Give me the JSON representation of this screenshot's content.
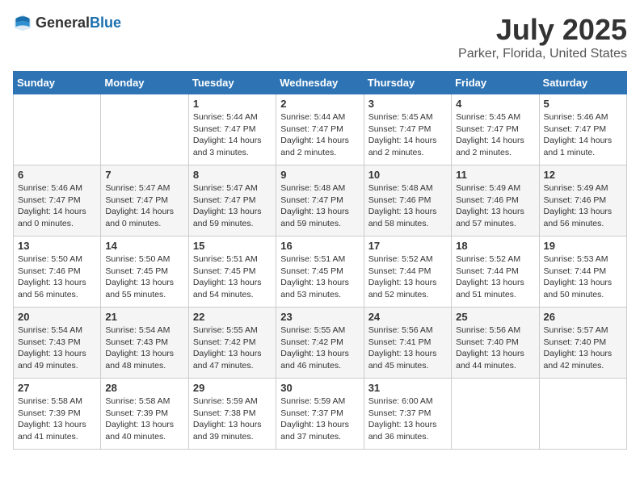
{
  "logo": {
    "general": "General",
    "blue": "Blue"
  },
  "title": {
    "month": "July 2025",
    "location": "Parker, Florida, United States"
  },
  "headers": [
    "Sunday",
    "Monday",
    "Tuesday",
    "Wednesday",
    "Thursday",
    "Friday",
    "Saturday"
  ],
  "weeks": [
    [
      {
        "day": "",
        "info": ""
      },
      {
        "day": "",
        "info": ""
      },
      {
        "day": "1",
        "info": "Sunrise: 5:44 AM\nSunset: 7:47 PM\nDaylight: 14 hours\nand 3 minutes."
      },
      {
        "day": "2",
        "info": "Sunrise: 5:44 AM\nSunset: 7:47 PM\nDaylight: 14 hours\nand 2 minutes."
      },
      {
        "day": "3",
        "info": "Sunrise: 5:45 AM\nSunset: 7:47 PM\nDaylight: 14 hours\nand 2 minutes."
      },
      {
        "day": "4",
        "info": "Sunrise: 5:45 AM\nSunset: 7:47 PM\nDaylight: 14 hours\nand 2 minutes."
      },
      {
        "day": "5",
        "info": "Sunrise: 5:46 AM\nSunset: 7:47 PM\nDaylight: 14 hours\nand 1 minute."
      }
    ],
    [
      {
        "day": "6",
        "info": "Sunrise: 5:46 AM\nSunset: 7:47 PM\nDaylight: 14 hours\nand 0 minutes."
      },
      {
        "day": "7",
        "info": "Sunrise: 5:47 AM\nSunset: 7:47 PM\nDaylight: 14 hours\nand 0 minutes."
      },
      {
        "day": "8",
        "info": "Sunrise: 5:47 AM\nSunset: 7:47 PM\nDaylight: 13 hours\nand 59 minutes."
      },
      {
        "day": "9",
        "info": "Sunrise: 5:48 AM\nSunset: 7:47 PM\nDaylight: 13 hours\nand 59 minutes."
      },
      {
        "day": "10",
        "info": "Sunrise: 5:48 AM\nSunset: 7:46 PM\nDaylight: 13 hours\nand 58 minutes."
      },
      {
        "day": "11",
        "info": "Sunrise: 5:49 AM\nSunset: 7:46 PM\nDaylight: 13 hours\nand 57 minutes."
      },
      {
        "day": "12",
        "info": "Sunrise: 5:49 AM\nSunset: 7:46 PM\nDaylight: 13 hours\nand 56 minutes."
      }
    ],
    [
      {
        "day": "13",
        "info": "Sunrise: 5:50 AM\nSunset: 7:46 PM\nDaylight: 13 hours\nand 56 minutes."
      },
      {
        "day": "14",
        "info": "Sunrise: 5:50 AM\nSunset: 7:45 PM\nDaylight: 13 hours\nand 55 minutes."
      },
      {
        "day": "15",
        "info": "Sunrise: 5:51 AM\nSunset: 7:45 PM\nDaylight: 13 hours\nand 54 minutes."
      },
      {
        "day": "16",
        "info": "Sunrise: 5:51 AM\nSunset: 7:45 PM\nDaylight: 13 hours\nand 53 minutes."
      },
      {
        "day": "17",
        "info": "Sunrise: 5:52 AM\nSunset: 7:44 PM\nDaylight: 13 hours\nand 52 minutes."
      },
      {
        "day": "18",
        "info": "Sunrise: 5:52 AM\nSunset: 7:44 PM\nDaylight: 13 hours\nand 51 minutes."
      },
      {
        "day": "19",
        "info": "Sunrise: 5:53 AM\nSunset: 7:44 PM\nDaylight: 13 hours\nand 50 minutes."
      }
    ],
    [
      {
        "day": "20",
        "info": "Sunrise: 5:54 AM\nSunset: 7:43 PM\nDaylight: 13 hours\nand 49 minutes."
      },
      {
        "day": "21",
        "info": "Sunrise: 5:54 AM\nSunset: 7:43 PM\nDaylight: 13 hours\nand 48 minutes."
      },
      {
        "day": "22",
        "info": "Sunrise: 5:55 AM\nSunset: 7:42 PM\nDaylight: 13 hours\nand 47 minutes."
      },
      {
        "day": "23",
        "info": "Sunrise: 5:55 AM\nSunset: 7:42 PM\nDaylight: 13 hours\nand 46 minutes."
      },
      {
        "day": "24",
        "info": "Sunrise: 5:56 AM\nSunset: 7:41 PM\nDaylight: 13 hours\nand 45 minutes."
      },
      {
        "day": "25",
        "info": "Sunrise: 5:56 AM\nSunset: 7:40 PM\nDaylight: 13 hours\nand 44 minutes."
      },
      {
        "day": "26",
        "info": "Sunrise: 5:57 AM\nSunset: 7:40 PM\nDaylight: 13 hours\nand 42 minutes."
      }
    ],
    [
      {
        "day": "27",
        "info": "Sunrise: 5:58 AM\nSunset: 7:39 PM\nDaylight: 13 hours\nand 41 minutes."
      },
      {
        "day": "28",
        "info": "Sunrise: 5:58 AM\nSunset: 7:39 PM\nDaylight: 13 hours\nand 40 minutes."
      },
      {
        "day": "29",
        "info": "Sunrise: 5:59 AM\nSunset: 7:38 PM\nDaylight: 13 hours\nand 39 minutes."
      },
      {
        "day": "30",
        "info": "Sunrise: 5:59 AM\nSunset: 7:37 PM\nDaylight: 13 hours\nand 37 minutes."
      },
      {
        "day": "31",
        "info": "Sunrise: 6:00 AM\nSunset: 7:37 PM\nDaylight: 13 hours\nand 36 minutes."
      },
      {
        "day": "",
        "info": ""
      },
      {
        "day": "",
        "info": ""
      }
    ]
  ]
}
